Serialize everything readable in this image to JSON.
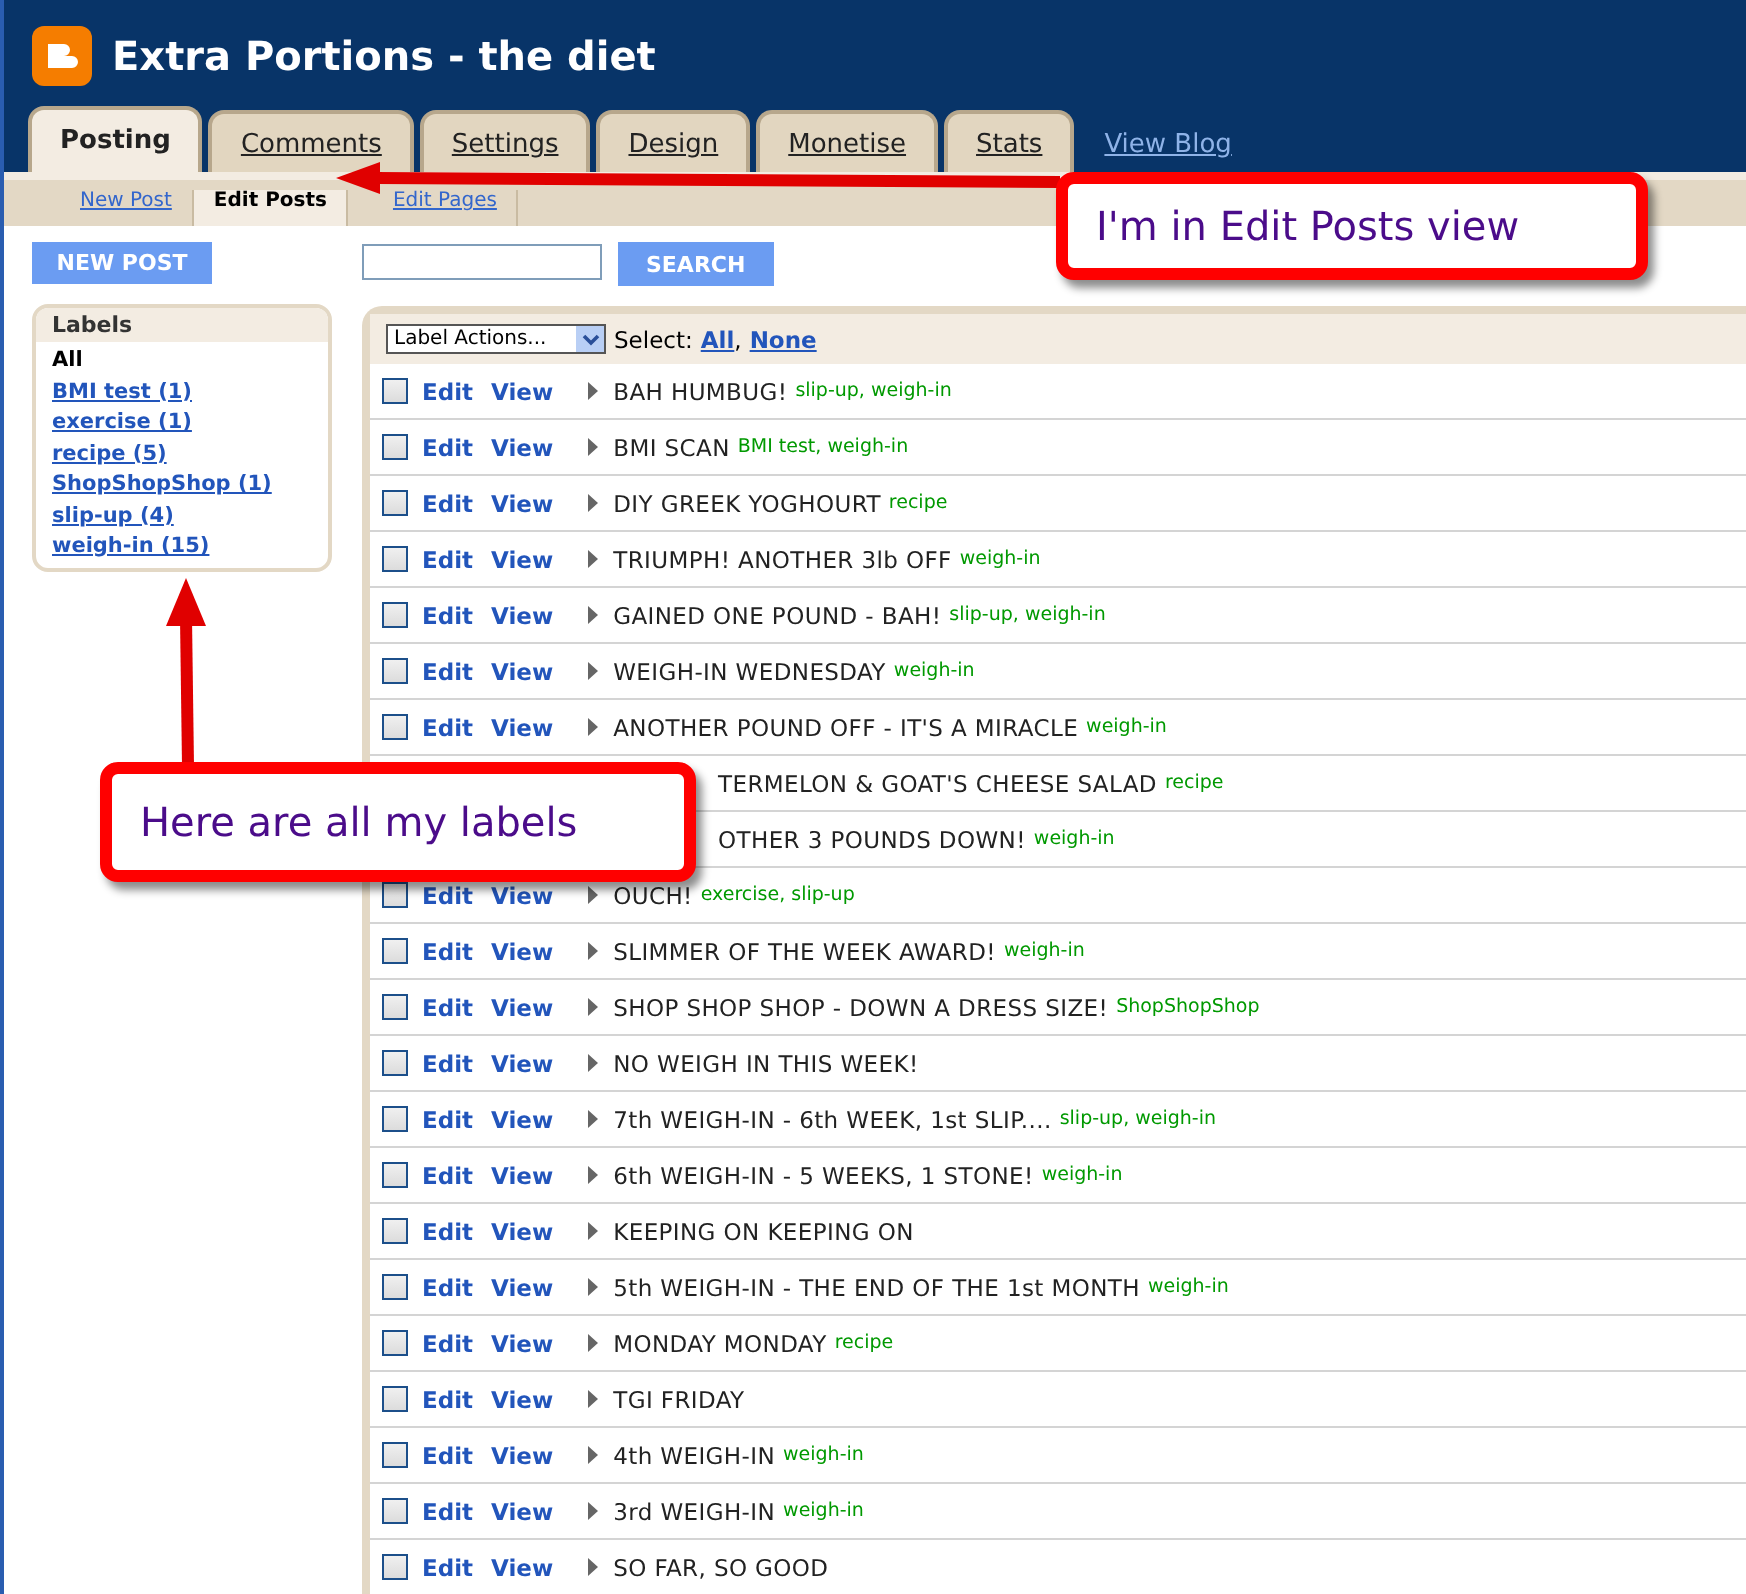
{
  "header": {
    "title": "Extra Portions - the diet"
  },
  "tabs": [
    {
      "label": "Posting",
      "selected": true
    },
    {
      "label": "Comments",
      "selected": false
    },
    {
      "label": "Settings",
      "selected": false
    },
    {
      "label": "Design",
      "selected": false
    },
    {
      "label": "Monetise",
      "selected": false
    },
    {
      "label": "Stats",
      "selected": false
    }
  ],
  "view_blog": "View Blog",
  "subtabs": [
    {
      "label": "New Post",
      "selected": false
    },
    {
      "label": "Edit Posts",
      "selected": true
    },
    {
      "label": "Edit Pages",
      "selected": false
    }
  ],
  "new_post_button": "NEW POST",
  "search_button": "SEARCH",
  "labels_panel": {
    "title": "Labels",
    "items": [
      {
        "label": "All",
        "selected": true
      },
      {
        "label": "BMI test (1)",
        "selected": false
      },
      {
        "label": "exercise (1)",
        "selected": false
      },
      {
        "label": "recipe (5)",
        "selected": false
      },
      {
        "label": "ShopShopShop (1)",
        "selected": false
      },
      {
        "label": "slip-up (4)",
        "selected": false
      },
      {
        "label": "weigh-in (15)",
        "selected": false
      }
    ]
  },
  "toolbar": {
    "label_actions": "Label Actions...",
    "select_label": "Select:",
    "select_all": "All",
    "separator": ",",
    "select_none": "None"
  },
  "posts": [
    {
      "edit": "Edit",
      "view": "View",
      "title": "BAH HUMBUG!",
      "labels": "slip-up, weigh-in",
      "checked": false
    },
    {
      "edit": "Edit",
      "view": "View",
      "title": "BMI SCAN",
      "labels": "BMI test, weigh-in",
      "checked": false
    },
    {
      "edit": "Edit",
      "view": "View",
      "title": "DIY GREEK YOGHOURT",
      "labels": "recipe",
      "checked": false
    },
    {
      "edit": "Edit",
      "view": "View",
      "title": "TRIUMPH! ANOTHER 3lb OFF",
      "labels": "weigh-in",
      "checked": false
    },
    {
      "edit": "Edit",
      "view": "View",
      "title": "GAINED ONE POUND - BAH!",
      "labels": "slip-up, weigh-in",
      "checked": false
    },
    {
      "edit": "Edit",
      "view": "View",
      "title": "WEIGH-IN WEDNESDAY",
      "labels": "weigh-in",
      "checked": false
    },
    {
      "edit": "Edit",
      "view": "View",
      "title": "ANOTHER POUND OFF - IT'S A MIRACLE",
      "labels": "weigh-in",
      "checked": false
    },
    {
      "title": "TERMELON & GOAT'S CHEESE SALAD",
      "labels": "recipe",
      "covered": true
    },
    {
      "title": "OTHER 3 POUNDS DOWN!",
      "labels": "weigh-in",
      "covered": true
    },
    {
      "edit": "Edit",
      "view": "View",
      "title": "OUCH!",
      "labels": "exercise, slip-up",
      "checked": false
    },
    {
      "edit": "Edit",
      "view": "View",
      "title": "SLIMMER OF THE WEEK AWARD!",
      "labels": "weigh-in",
      "checked": false
    },
    {
      "edit": "Edit",
      "view": "View",
      "title": "SHOP SHOP SHOP - DOWN A DRESS SIZE!",
      "labels": "ShopShopShop",
      "checked": false
    },
    {
      "edit": "Edit",
      "view": "View",
      "title": "NO WEIGH IN THIS WEEK!",
      "checked": false
    },
    {
      "edit": "Edit",
      "view": "View",
      "title": "7th WEIGH-IN - 6th WEEK, 1st SLIP....",
      "labels": "slip-up, weigh-in",
      "checked": false
    },
    {
      "edit": "Edit",
      "view": "View",
      "title": "6th WEIGH-IN - 5 WEEKS, 1 STONE!",
      "labels": "weigh-in",
      "checked": false
    },
    {
      "edit": "Edit",
      "view": "View",
      "title": "KEEPING ON KEEPING ON",
      "checked": false
    },
    {
      "edit": "Edit",
      "view": "View",
      "title": "5th WEIGH-IN - THE END OF THE 1st MONTH",
      "labels": "weigh-in",
      "checked": false
    },
    {
      "edit": "Edit",
      "view": "View",
      "title": "MONDAY MONDAY",
      "labels": "recipe",
      "checked": false
    },
    {
      "edit": "Edit",
      "view": "View",
      "title": "TGI FRIDAY",
      "checked": false
    },
    {
      "edit": "Edit",
      "view": "View",
      "title": "4th WEIGH-IN",
      "labels": "weigh-in",
      "checked": false
    },
    {
      "edit": "Edit",
      "view": "View",
      "title": "3rd WEIGH-IN",
      "labels": "weigh-in",
      "checked": false
    },
    {
      "edit": "Edit",
      "view": "View",
      "title": "SO FAR, SO GOOD",
      "checked": false
    }
  ],
  "callouts": [
    {
      "text": "I'm in Edit Posts view",
      "kind": "left"
    },
    {
      "text": "Here are all my labels",
      "kind": "up"
    }
  ]
}
